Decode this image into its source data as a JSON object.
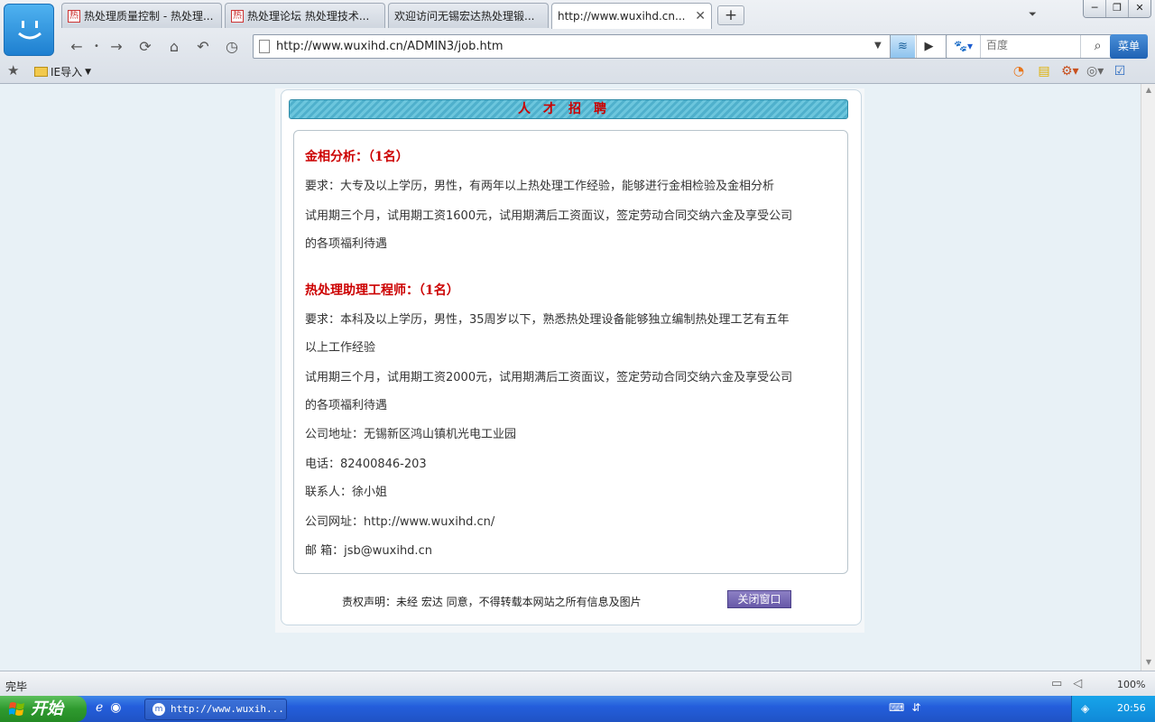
{
  "browser": {
    "tabs": [
      {
        "label": "热处理质量控制 - 热处理...",
        "favicon": "热",
        "active": false
      },
      {
        "label": "热处理论坛 热处理技术...",
        "favicon": "热",
        "active": false
      },
      {
        "label": "欢迎访问无锡宏达热处理锻...",
        "favicon": "",
        "active": false
      },
      {
        "label": "http://www.wuxihd.cn...",
        "favicon": "",
        "active": true
      }
    ],
    "new_tab_symbol": "+",
    "url": "http://www.wuxihd.cn/ADMIN3/job.htm",
    "search_placeholder": "百度",
    "menu_label": "菜单",
    "favorites_folder": "IE导入",
    "status_text": "完毕",
    "zoom": "100%"
  },
  "page": {
    "heading": "人才招聘",
    "jobs": [
      {
        "title": "金相分析：（1名）",
        "lines": [
          "要求：大专及以上学历，男性，有两年以上热处理工作经验，能够进行金相检验及金相分析",
          "试用期三个月，试用期工资1600元，试用期满后工资面议，签定劳动合同交纳六金及享受公司",
          "的各项福利待遇"
        ]
      },
      {
        "title": "热处理助理工程师：（1名）",
        "lines": [
          "要求：本科及以上学历，男性，35周岁以下，熟悉热处理设备能够独立编制热处理工艺有五年",
          "以上工作经验",
          "试用期三个月，试用期工资2000元，试用期满后工资面议，签定劳动合同交纳六金及享受公司",
          "的各项福利待遇"
        ]
      }
    ],
    "contact": {
      "address": "公司地址：无锡新区鸿山镇机光电工业园",
      "phone": "电话：82400846-203",
      "person": "联系人：徐小姐",
      "website": "公司网址：http://www.wuxihd.cn/",
      "email": "邮 箱：jsb@wuxihd.cn"
    },
    "copyright_note": "责权声明：未经 宏达 同意，不得转载本网站之所有信息及图片",
    "close_button": "关闭窗口"
  },
  "taskbar": {
    "start_label": "开始",
    "task_label": "http://www.wuxih...",
    "clock": "20:56"
  },
  "colors": {
    "heading_red": "#cc0000",
    "title_bar_teal": "#4fb0cc",
    "close_button_purple": "#6759a8",
    "taskbar_blue": "#245edc"
  }
}
